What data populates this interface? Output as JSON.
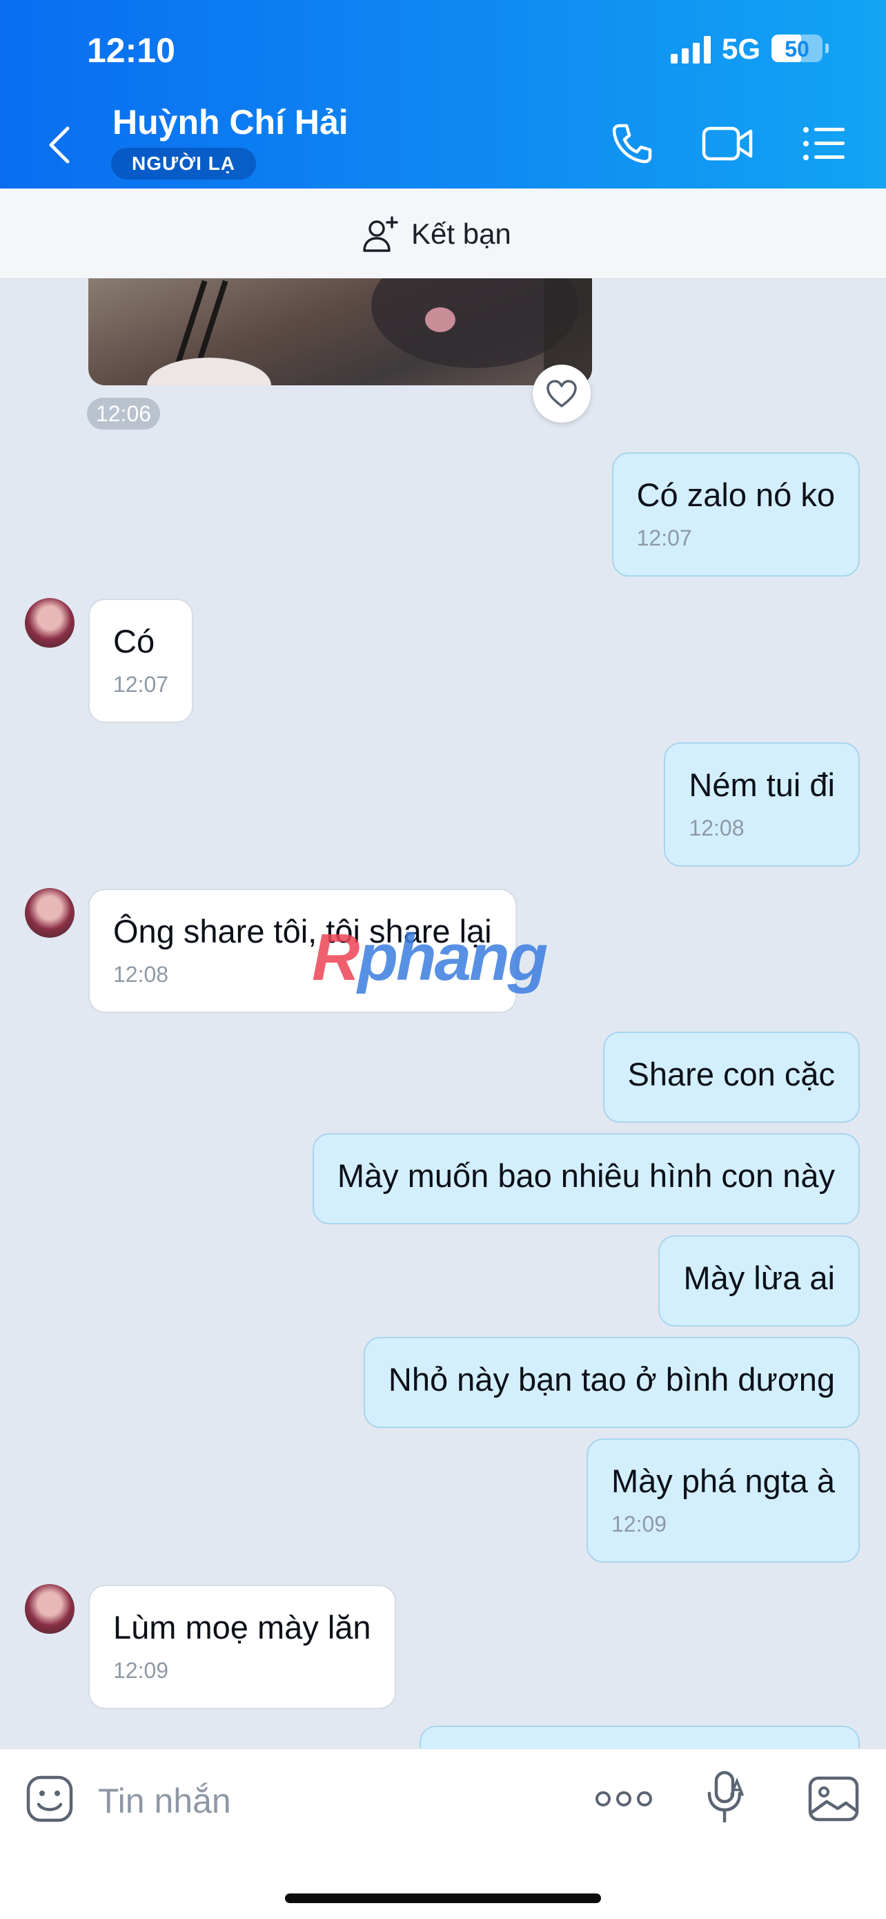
{
  "status": {
    "time": "12:10",
    "network": "5G",
    "battery": "50"
  },
  "header": {
    "name": "Huỳnh Chí Hải",
    "badge": "NGƯỜI LẠ"
  },
  "friend_bar": {
    "label": "Kết bạn"
  },
  "image_message": {
    "time": "12:06"
  },
  "messages": [
    {
      "dir": "out",
      "text": "Có zalo nó ko",
      "time": "12:07"
    },
    {
      "dir": "in",
      "text": "Có",
      "time": "12:07"
    },
    {
      "dir": "out",
      "text": "Ném tui đi",
      "time": "12:08"
    },
    {
      "dir": "in",
      "text": "Ông share tôi, tôi share lại",
      "time": "12:08"
    },
    {
      "dir": "out",
      "text": "Share con cặc",
      "time": ""
    },
    {
      "dir": "out",
      "text": "Mày muốn bao nhiêu hình con này",
      "time": ""
    },
    {
      "dir": "out",
      "text": "Mày lừa ai",
      "time": ""
    },
    {
      "dir": "out",
      "text": "Nhỏ này bạn tao ở bình dương",
      "time": ""
    },
    {
      "dir": "out",
      "text": "Mày phá ngta à",
      "time": "12:09"
    },
    {
      "dir": "in",
      "text": "Lùm moẹ mày lăn",
      "time": "12:09"
    }
  ],
  "watermark": {
    "r": "R",
    "rest": "phang"
  },
  "input": {
    "placeholder": "Tin nhắn"
  },
  "colors": {
    "header_start": "#0a6df0",
    "header_end": "#12a4f3",
    "out_bubble": "#d3effd",
    "in_bubble": "#ffffff",
    "chat_bg": "#e2e8f1"
  }
}
